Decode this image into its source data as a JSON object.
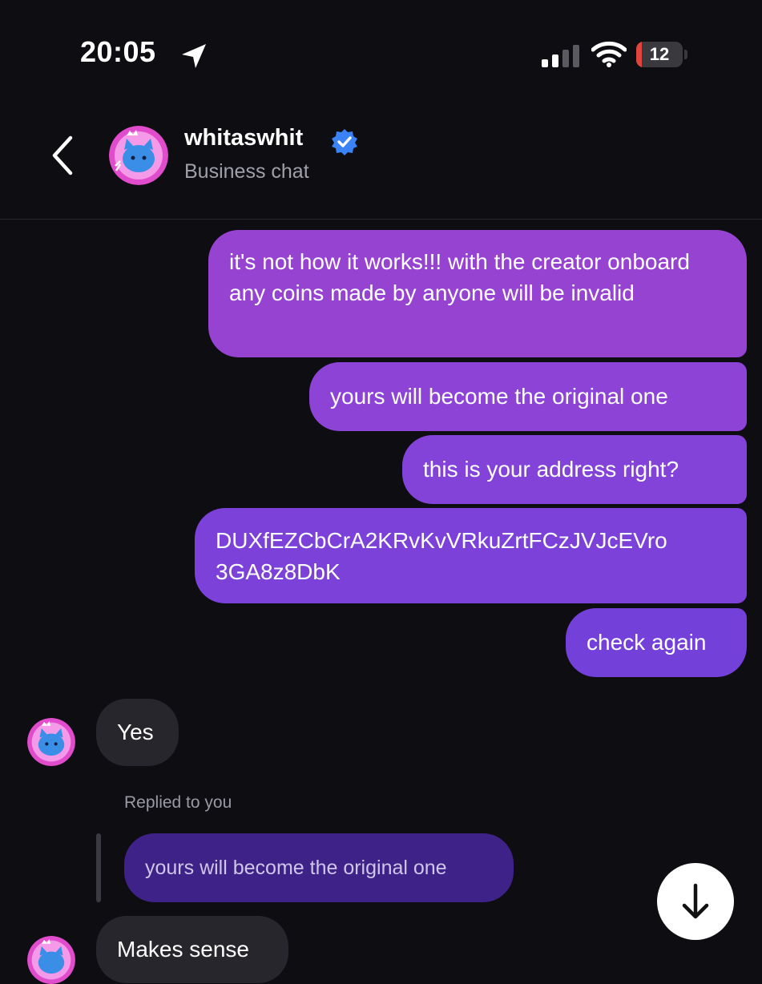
{
  "status_bar": {
    "time": "20:05",
    "battery_level": "12"
  },
  "header": {
    "name": "whitaswhit",
    "subtitle": "Business chat"
  },
  "messages": {
    "outgoing": [
      "it's not how it works!!! with the creator onboard any coins made by anyone will be invalid",
      "yours will become the original one",
      "this is your address right?",
      {
        "line1": "DUXfEZCbCrA2KRvKvVRkuZrtFCzJVJcEVro",
        "line2": "3GA8z8DbK"
      },
      "check again"
    ],
    "incoming": [
      "Yes",
      "Makes sense"
    ],
    "reply_label": "Replied to you",
    "reply_quote": "yours will become the original one"
  },
  "colors": {
    "background": "#0d0d12",
    "outgoing_top": "#9743d2",
    "outgoing_bottom": "#7440da",
    "incoming": "#26262c",
    "verified": "#3b82f6"
  },
  "icons": [
    "location-arrow-icon",
    "signal-icon",
    "wifi-icon",
    "battery-icon",
    "back-chevron-icon",
    "verified-badge-icon",
    "scroll-down-arrow-icon"
  ]
}
